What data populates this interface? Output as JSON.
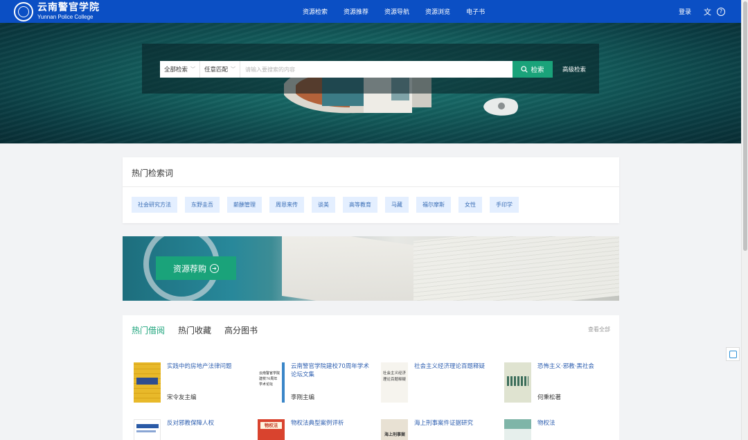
{
  "header": {
    "logo_cn": "云南警官学院",
    "logo_en": "Yunnan Police College",
    "nav": [
      "资源检索",
      "资源推荐",
      "资源导航",
      "资源浏览",
      "电子书"
    ],
    "login": "登录",
    "translate_glyph": "文",
    "help_glyph": "?"
  },
  "search": {
    "scope": "全部检索",
    "match": "任意匹配",
    "placeholder": "请输入要搜索的内容",
    "button": "检索",
    "advanced": "高级检索"
  },
  "hot": {
    "title": "热门检索词",
    "tags": [
      "社会研究方法",
      "东野圭吾",
      "薪酬管理",
      "周恩来传",
      "谈美",
      "高等教育",
      "马藏",
      "福尔摩斯",
      "女性",
      "手印学"
    ]
  },
  "banner": {
    "button": "资源荐购"
  },
  "books": {
    "tabs": [
      "热门借阅",
      "热门收藏",
      "高分图书"
    ],
    "view_all": "查看全部",
    "items": [
      {
        "title": "实践中的房地产法律问题",
        "author": "宋令友主编"
      },
      {
        "title": "云南警官学院建校70周年学术论坛文集",
        "author": "李刚主编"
      },
      {
        "title": "社会主义经济理论百题释疑",
        "author": ""
      },
      {
        "title": "恐怖主义·邪教·黑社会",
        "author": "何秉松著"
      },
      {
        "title": "反对邪教保障人权",
        "author": ""
      },
      {
        "title": "物权法典型案例评析",
        "author": ""
      },
      {
        "title": "海上刑事案件证据研究",
        "author": ""
      },
      {
        "title": "物权法",
        "author": ""
      }
    ],
    "cover_texts": [
      "云南警官学院建校70周年学术论坛",
      "社会主义经济理论百题释疑",
      "物权法",
      "海上刑事案"
    ]
  },
  "colors": {
    "primary": "#0b4fc4",
    "accent": "#1aa37a",
    "tag_bg": "#e4efff",
    "link": "#2e5fb0"
  }
}
